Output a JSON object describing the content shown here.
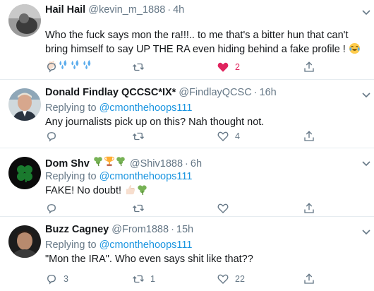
{
  "colors": {
    "link": "#1b95e0",
    "secondary": "#657786",
    "like": "#e0245e",
    "divider": "#e6ecf0"
  },
  "tweets": [
    {
      "name": "Hail Hail",
      "handle": "@kevin_m_1888",
      "dot": "·",
      "time": "4h",
      "text": "Who the fuck says mon the ra!!!.. to me that's a bitter hun that can't bring himself to say UP THE RA even hiding behind a fake profile !",
      "emoji": [
        "face-with-tears-of-joy",
        "clapping-hands",
        "sweat-droplets",
        "sweat-droplets",
        "sweat-droplets"
      ],
      "replies": "",
      "retweets": "",
      "likes": "2",
      "liked": true
    },
    {
      "name": "Donald Findlay QCCSC*IX*",
      "handle": "@FindlayQCSC",
      "dot": "·",
      "time": "16h",
      "reply_prefix": "Replying to",
      "reply_to": "@cmonthehoops111",
      "text": "Any journalists pick up on this? Nah thought not.",
      "replies": "",
      "retweets": "",
      "likes": "4"
    },
    {
      "name": "Dom Shv",
      "name_emoji": [
        "shamrock",
        "trophy",
        "shamrock"
      ],
      "handle": "@Shiv1888",
      "dot": "·",
      "time": "6h",
      "reply_prefix": "Replying to",
      "reply_to": "@cmonthehoops111",
      "text": "FAKE! No doubt!",
      "emoji": [
        "thumbs-up",
        "shamrock"
      ],
      "replies": "",
      "retweets": "",
      "likes": ""
    },
    {
      "name": "Buzz Cagney",
      "handle": "@From1888",
      "dot": "·",
      "time": "15h",
      "reply_prefix": "Replying to",
      "reply_to": "@cmonthehoops111",
      "text": "\"Mon the IRA\". Who even says shit like that??",
      "replies": "3",
      "retweets": "1",
      "likes": "22"
    }
  ]
}
